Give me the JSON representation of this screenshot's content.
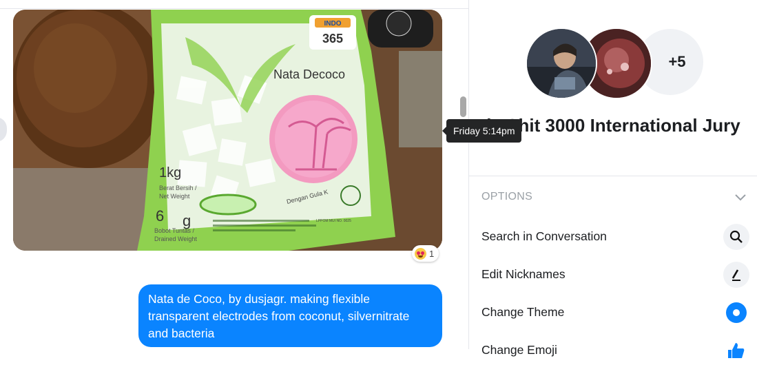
{
  "chat": {
    "photo": {
      "labels": {
        "brand": "INDO",
        "brand_number": "365",
        "product": "Nata Decoco",
        "weight": "1kg",
        "weight_small_1": "Berat Bersih /",
        "weight_small_2": "Net Weight",
        "drained": "6",
        "drained_end": "g",
        "drained_small_1": "Bobot Tuntas /",
        "drained_small_2": "Drained Weight",
        "curve_text": "Dengan Gula K",
        "lppom": "LPPOM MUI NO. 0025"
      }
    },
    "reaction": {
      "icon": "heart-eyes-emoji-icon",
      "count": "1"
    },
    "message": "Nata de Coco, by dusjagr. making flexible transparent electrodes from coconut, silvernitrate and bacteria",
    "tooltip": "Friday 5:14pm",
    "accent": "#0a84ff"
  },
  "panel": {
    "extra_members": "+5",
    "title": "keShit 3000 International Jury",
    "options_label": "OPTIONS",
    "options": [
      {
        "label": "Search in Conversation",
        "icon": "search-icon"
      },
      {
        "label": "Edit Nicknames",
        "icon": "pencil-icon"
      },
      {
        "label": "Change Theme",
        "icon": "theme-circle-icon"
      },
      {
        "label": "Change Emoji",
        "icon": "thumbs-up-icon"
      }
    ]
  }
}
